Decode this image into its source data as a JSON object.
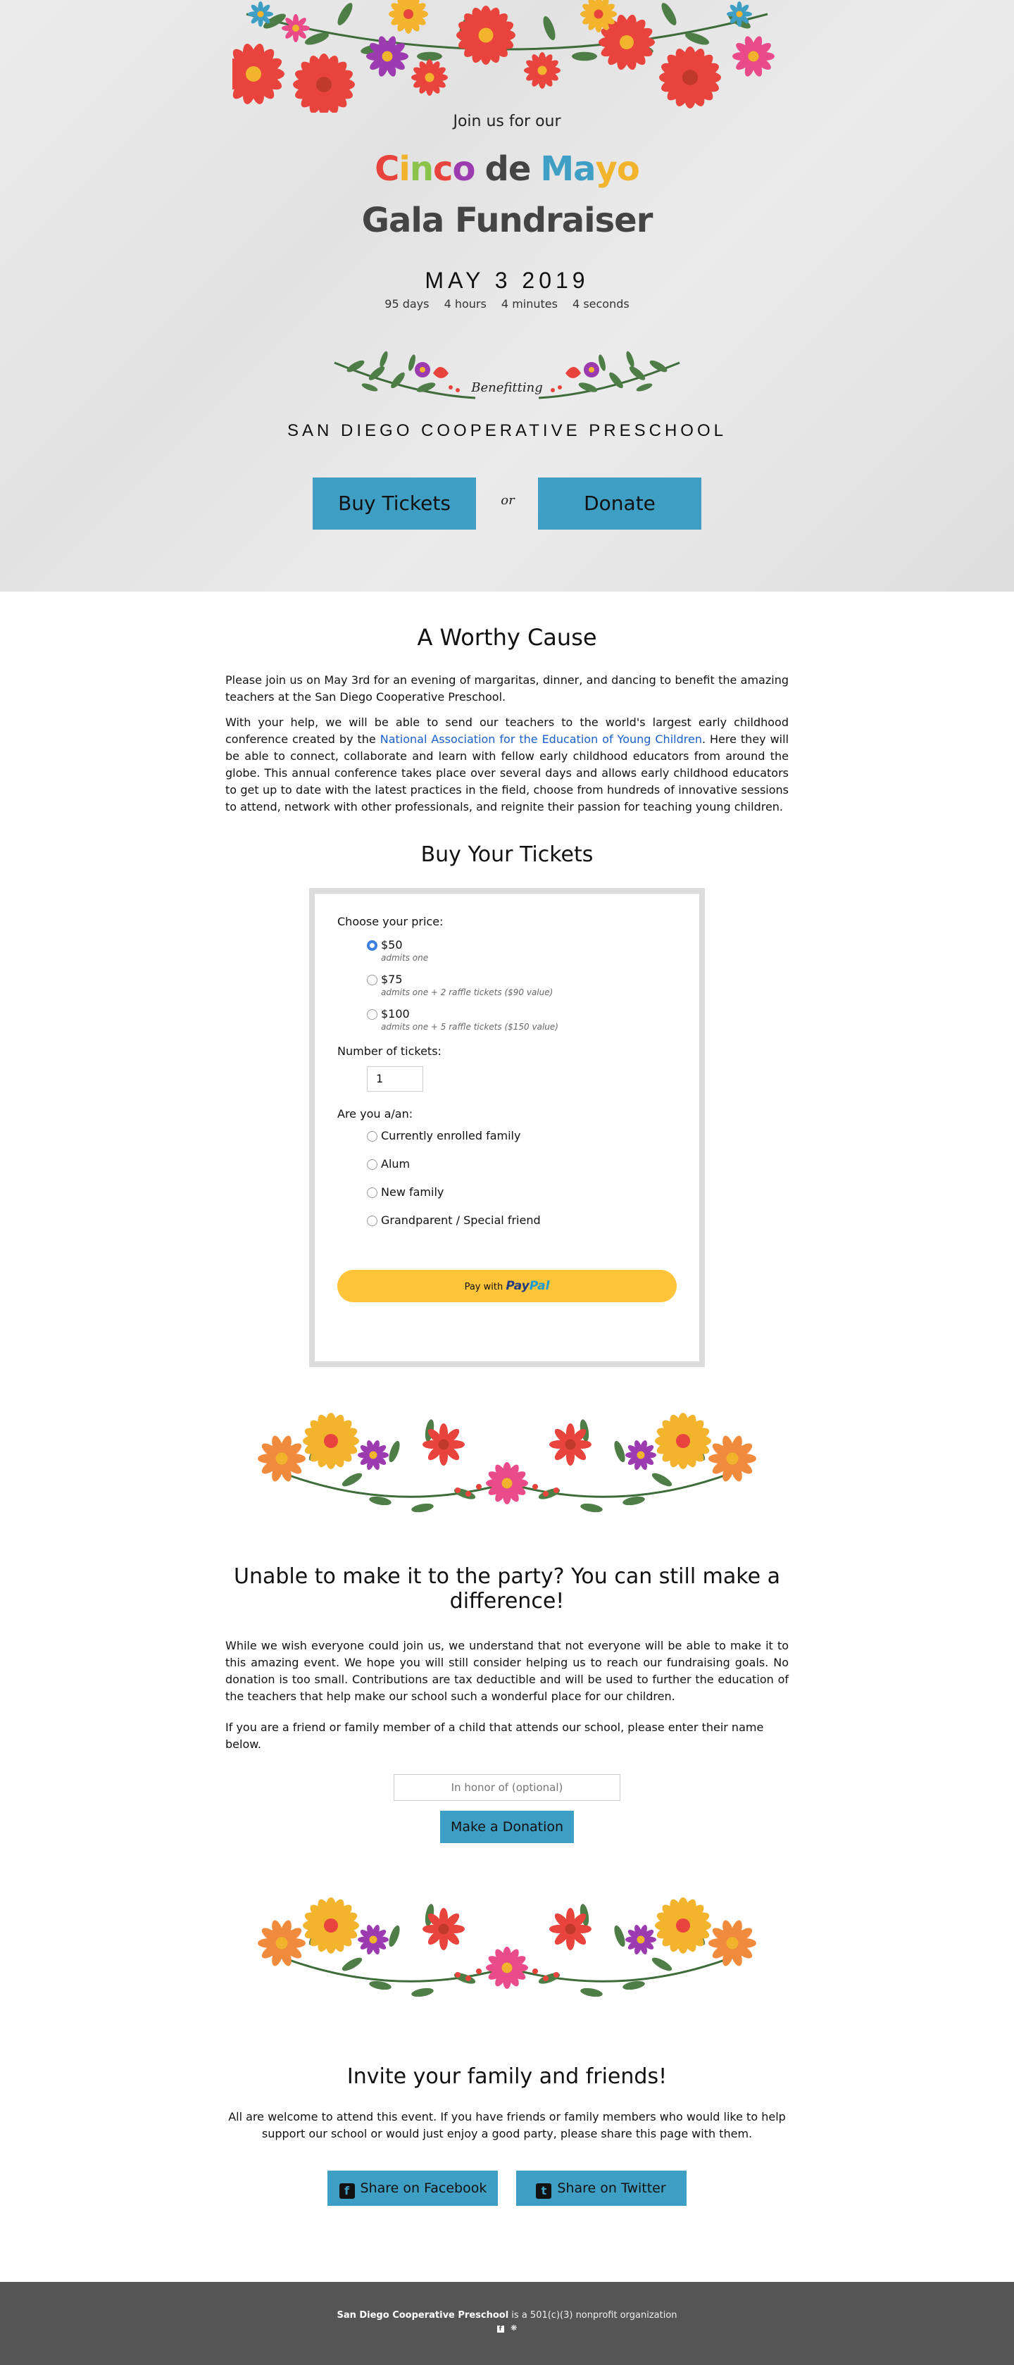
{
  "hero": {
    "intro": "Join us for our",
    "title_letters": [
      {
        "ch": "C",
        "color": "#e8433c"
      },
      {
        "ch": "i",
        "color": "#f2b42c"
      },
      {
        "ch": "n",
        "color": "#8bc34a"
      },
      {
        "ch": "c",
        "color": "#e8433c"
      },
      {
        "ch": "o",
        "color": "#9c3bb0"
      },
      {
        "ch": " ",
        "color": "#444444"
      },
      {
        "ch": "d",
        "color": "#444444"
      },
      {
        "ch": "e",
        "color": "#444444"
      },
      {
        "ch": " ",
        "color": "#444444"
      },
      {
        "ch": "M",
        "color": "#3f9ec3"
      },
      {
        "ch": "a",
        "color": "#3f9ec3"
      },
      {
        "ch": "y",
        "color": "#f2b42c"
      },
      {
        "ch": "o",
        "color": "#f2b42c"
      }
    ],
    "subtitle": "Gala Fundraiser",
    "date": "MAY 3 2019",
    "countdown": {
      "days": "95 days",
      "hours": "4 hours",
      "minutes": "4 minutes",
      "seconds": "4 seconds"
    },
    "benefiting": "Benefitting",
    "school": "SAN DIEGO COOPERATIVE PRESCHOOL",
    "buy_label": "Buy Tickets",
    "or_label": "or",
    "donate_label": "Donate"
  },
  "cause": {
    "title": "A Worthy Cause",
    "p1": "Please join us on May 3rd for an evening of margaritas, dinner, and dancing to benefit the amazing teachers at the San Diego Cooperative Preschool.",
    "p2_before": "With your help, we will be able to send our teachers to the world's largest early childhood conference created by the ",
    "p2_link": "National Association for the Education of Young Children",
    "p2_after": ". Here they will be able to connect, collaborate and learn with fellow early childhood educators from around the globe. This annual conference takes place over several days and allows early childhood educators to get up to date with the latest practices in the field, choose from hundreds of innovative sessions to attend, network with other professionals, and reignite their passion for teaching young children."
  },
  "tickets": {
    "title": "Buy Your Tickets",
    "price_label": "Choose your price:",
    "prices": [
      {
        "value": "$50",
        "sub": "admits one",
        "selected": true
      },
      {
        "value": "$75",
        "sub": "admits one + 2 raffle tickets ($90 value)",
        "selected": false
      },
      {
        "value": "$100",
        "sub": "admits one + 5 raffle tickets ($150 value)",
        "selected": false
      }
    ],
    "qty_label": "Number of tickets:",
    "qty_value": "1",
    "role_label": "Are you a/an:",
    "roles": [
      "Currently enrolled family",
      "Alum",
      "New family",
      "Grandparent / Special friend"
    ],
    "paypal_prefix": "Pay with",
    "paypal_pay": "Pay",
    "paypal_pal": "Pal"
  },
  "difference": {
    "title": "Unable to make it to the party? You can still make a difference!",
    "p1": "While we wish everyone could join us, we understand that not everyone will be able to make it to this amazing event. We hope you will still consider helping us to reach our fundraising goals. No donation is too small. Contributions are tax deductible and will be used to further the education of the teachers that help make our school such a wonderful place for our children.",
    "p2": "If you are a friend or family member of a child that attends our school, please enter their name below.",
    "honor_placeholder": "In honor of (optional)",
    "donation_label": "Make a Donation"
  },
  "invite": {
    "title": "Invite your family and friends!",
    "p": "All are welcome to attend this event. If you have friends or family members who would like to help support our school or would just enjoy a good party, please share this page with them.",
    "facebook_label": "Share on Facebook",
    "twitter_label": "Share on Twitter"
  },
  "footer": {
    "org": "San Diego Cooperative Preschool",
    "text": " is a 501(c)(3) nonprofit organization"
  },
  "colors": {
    "accent": "#3f9ec3",
    "paypal": "#ffc439",
    "footer": "#555555"
  },
  "icons": [
    "flower-garland-icon",
    "wreath-icon",
    "facebook-icon",
    "twitter-icon",
    "yelp-icon"
  ]
}
